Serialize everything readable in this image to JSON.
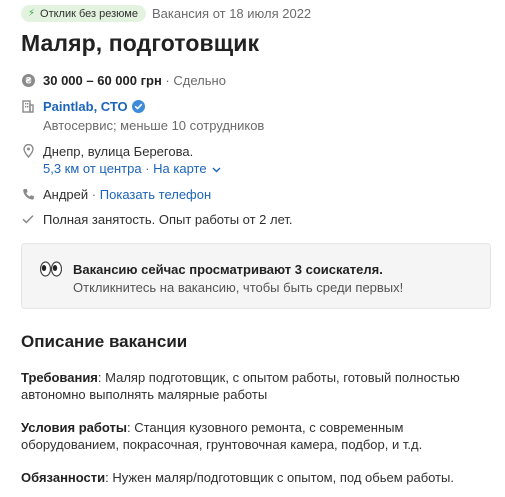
{
  "badge": {
    "label": "Отклик без резюме",
    "icon": "bolt-icon",
    "color": "#3aa44a"
  },
  "posted": "Вакансия от 18 июля 2022",
  "title": "Маляр, подготовщик",
  "salary": {
    "amount": "30 000 – 60 000 грн",
    "separator": "·",
    "type": "Сдельно",
    "icon": "currency-icon"
  },
  "company": {
    "name": "Paintlab, СТО",
    "verified_icon": "verified-check-icon",
    "description": "Автосервис; меньше 10 сотрудников",
    "icon": "building-icon"
  },
  "location": {
    "address": "Днепр, вулица Берегова.",
    "distance": "5,3 км от центра",
    "separator": "·",
    "map_link": "На карте",
    "icon": "pin-icon"
  },
  "contact": {
    "name": "Андрей",
    "separator": "·",
    "show_phone": "Показать телефон",
    "icon": "phone-icon"
  },
  "employment": {
    "text": "Полная занятость. Опыт работы от 2 лет.",
    "icon": "check-icon"
  },
  "notice": {
    "title": "Вакансию сейчас просматривают 3 соискателя.",
    "subtitle": "Откликнитесь на вакансию, чтобы быть среди первых!",
    "icon": "eyes-icon"
  },
  "description": {
    "heading": "Описание вакансии",
    "requirements_label": "Требования",
    "requirements_text": ": Маляр подготовщик, с опытом работы, готовый полностью автономно выполнять малярные работы",
    "conditions_label": "Условия работы",
    "conditions_text": ": Станция кузовного ремонта, с современным оборудованием, покрасочная, грунтовочная камера, подбор, и т.д.",
    "duties_label": "Обязанности",
    "duties_text": ": Нужен маляр/подготовщик с опытом, под обьем работы."
  },
  "colors": {
    "link": "#1c64b8",
    "muted": "#6b6b6b",
    "badge_bg": "#e4f3e0",
    "notice_bg": "#f5f5f5"
  }
}
